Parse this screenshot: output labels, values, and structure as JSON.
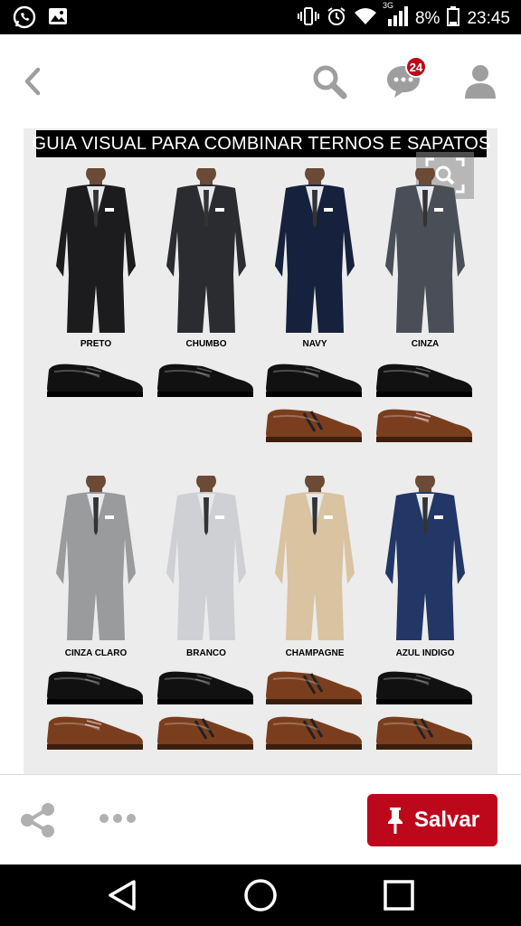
{
  "status_bar": {
    "network": "3G",
    "battery": "8%",
    "time": "23:45"
  },
  "header": {
    "back_icon": "chevron-left-icon",
    "notifications_count": "24"
  },
  "pin": {
    "title": "GUIA VISUAL PARA COMBINAR TERNOS E SAPATOS",
    "suits": [
      {
        "label": "PRETO",
        "color": "#1c1c1e"
      },
      {
        "label": "CHUMBO",
        "color": "#2a2c30"
      },
      {
        "label": "NAVY",
        "color": "#16213d"
      },
      {
        "label": "CINZA",
        "color": "#4a4f57"
      },
      {
        "label": "CINZA CLARO",
        "color": "#9a9b9d"
      },
      {
        "label": "BRANCO",
        "color": "#cfd0d4"
      },
      {
        "label": "CHAMPAGNE",
        "color": "#d9c3a0"
      },
      {
        "label": "AZUL INDIGO",
        "color": "#223766"
      }
    ]
  },
  "actions": {
    "save_label": "Salvar"
  },
  "colors": {
    "brand_red": "#bd081c",
    "icon_grey": "#9e9e9e"
  }
}
